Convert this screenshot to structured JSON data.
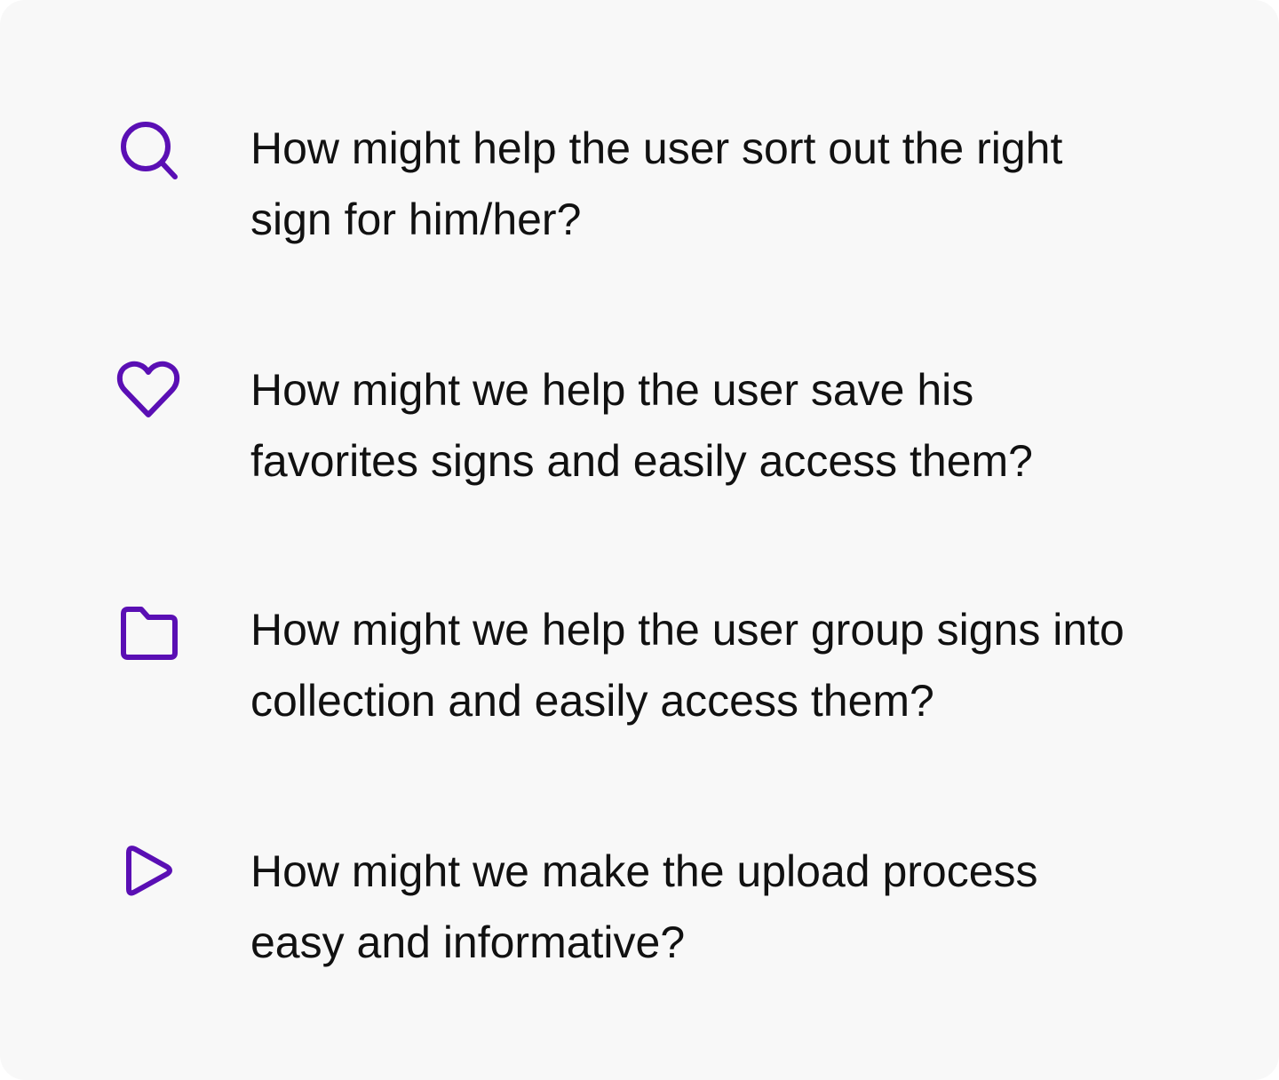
{
  "accent_color": "#5a0fb4",
  "background_color": "#f8f8f8",
  "text_color": "#111111",
  "items": [
    {
      "icon": "search-icon",
      "text": "How might help the user sort out the right sign for him/her?"
    },
    {
      "icon": "heart-icon",
      "text": "How might we help the user save his favorites signs and easily access them?"
    },
    {
      "icon": "folder-icon",
      "text": "How might we help the user group signs into collection and easily access them?"
    },
    {
      "icon": "play-icon",
      "text": "How might we make the upload process easy and informative?"
    }
  ]
}
